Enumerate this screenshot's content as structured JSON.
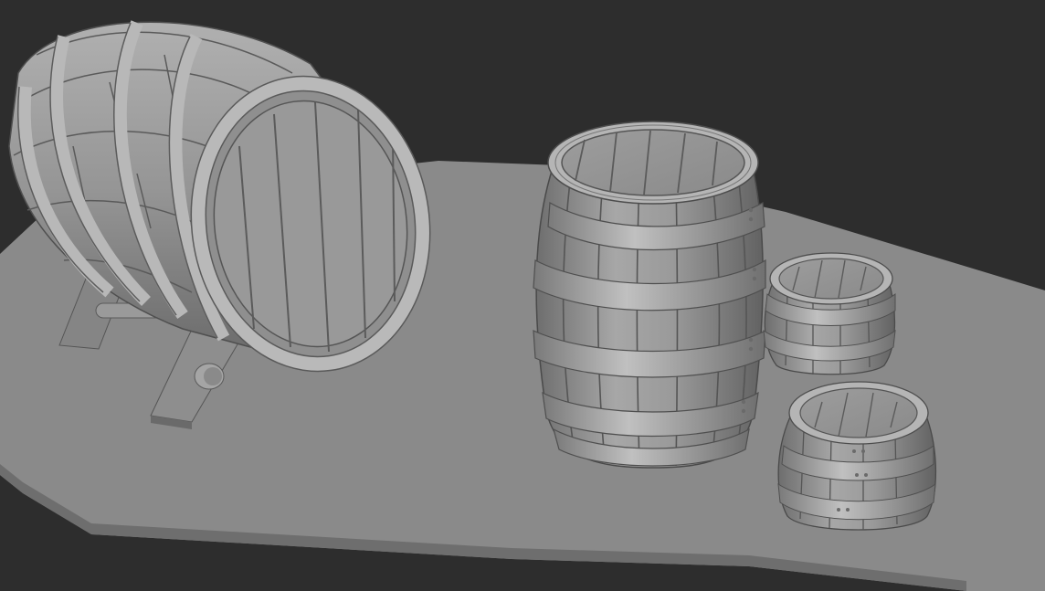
{
  "scene": {
    "background_color": "#2d2d2d",
    "ground_color": "#8c8c8c",
    "material_color": "#9a9a9a",
    "objects": [
      {
        "name": "barrel-on-stand",
        "icon": "barrel-lying-icon"
      },
      {
        "name": "standing-barrel",
        "icon": "barrel-upright-icon"
      },
      {
        "name": "small-keg-back",
        "icon": "keg-icon"
      },
      {
        "name": "small-keg-front",
        "icon": "keg-icon"
      }
    ]
  }
}
